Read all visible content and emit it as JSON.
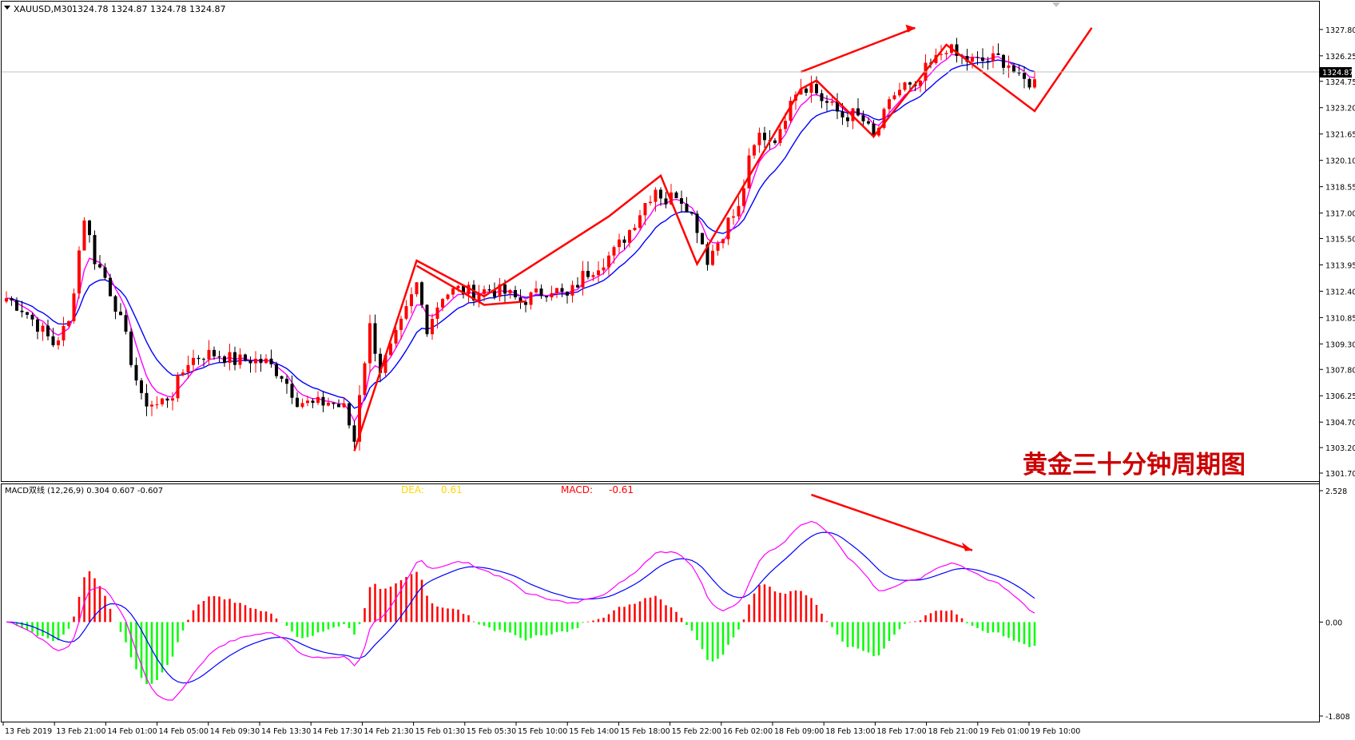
{
  "window": {
    "symbol_label": "XAUUSD,M30",
    "ohlc": "1324.78 1324.87 1324.78 1324.87",
    "title_cn": "黄金三十分钟周期图"
  },
  "colors": {
    "bull_candle": "#ff0000",
    "bear_candle": "#000000",
    "fast_ma": "#ff00ff",
    "slow_ma": "#0000ff",
    "macd_pos": "#ff0000",
    "macd_neg": "#00ff00",
    "trendline": "#ff0000",
    "title": "#cc0000",
    "dea_label": "#ffd700",
    "macd_label": "#ff0000"
  },
  "price_axis": {
    "ticks": [
      "1327.80",
      "1326.25",
      "1324.75",
      "1323.20",
      "1321.65",
      "1320.10",
      "1318.55",
      "1317.00",
      "1315.50",
      "1313.95",
      "1312.40",
      "1310.85",
      "1309.30",
      "1307.80",
      "1306.25",
      "1304.70",
      "1303.20",
      "1301.70"
    ],
    "current_price": "1324.87"
  },
  "time_axis": {
    "labels": [
      "13 Feb 2019",
      "13 Feb 21:00",
      "14 Feb 01:00",
      "14 Feb 05:00",
      "14 Feb 09:30",
      "14 Feb 13:30",
      "14 Feb 17:30",
      "14 Feb 21:30",
      "15 Feb 01:30",
      "15 Feb 05:30",
      "15 Feb 10:00",
      "15 Feb 14:00",
      "15 Feb 18:00",
      "15 Feb 22:00",
      "16 Feb 02:00",
      "18 Feb 09:00",
      "18 Feb 13:00",
      "18 Feb 17:00",
      "18 Feb 21:00",
      "19 Feb 01:00",
      "19 Feb 10:00"
    ]
  },
  "macd_panel": {
    "label": "MACD双线 (12,26,9) 0.304 0.607 -0.607",
    "dea_name": "DEA:",
    "dea_value": "0.61",
    "macd_name": "MACD:",
    "macd_value": "-0.61",
    "ticks": [
      "2.528",
      "0.00",
      "-1.808"
    ]
  },
  "chart_data": {
    "type": "candlestick",
    "symbol": "XAUUSD",
    "timeframe": "M30",
    "ylim": [
      1301.7,
      1328.5
    ],
    "price_path": [
      [
        0,
        1312.0
      ],
      [
        3,
        1311.4
      ],
      [
        6,
        1310.4
      ],
      [
        9,
        1309.3
      ],
      [
        12,
        1310.5
      ],
      [
        14,
        1314.8
      ],
      [
        15,
        1316.8
      ],
      [
        17,
        1314.3
      ],
      [
        19,
        1313.2
      ],
      [
        21,
        1311.6
      ],
      [
        23,
        1309.6
      ],
      [
        26,
        1306.0
      ],
      [
        29,
        1305.7
      ],
      [
        32,
        1306.4
      ],
      [
        35,
        1308.3
      ],
      [
        38,
        1308.7
      ],
      [
        41,
        1308.7
      ],
      [
        44,
        1308.3
      ],
      [
        47,
        1308.4
      ],
      [
        50,
        1308.2
      ],
      [
        53,
        1307.5
      ],
      [
        56,
        1306.0
      ],
      [
        59,
        1305.7
      ],
      [
        62,
        1305.9
      ],
      [
        65,
        1305.5
      ],
      [
        67,
        1303.6
      ],
      [
        68,
        1306.5
      ],
      [
        70,
        1310.3
      ],
      [
        72,
        1307.8
      ],
      [
        74,
        1309.0
      ],
      [
        76,
        1310.4
      ],
      [
        79,
        1312.8
      ],
      [
        81,
        1310.3
      ],
      [
        84,
        1312.2
      ],
      [
        87,
        1312.5
      ],
      [
        90,
        1312.3
      ],
      [
        93,
        1312.5
      ],
      [
        96,
        1312.3
      ],
      [
        99,
        1311.8
      ],
      [
        102,
        1312.2
      ],
      [
        105,
        1312.6
      ],
      [
        108,
        1312.0
      ],
      [
        111,
        1313.3
      ],
      [
        114,
        1314.0
      ],
      [
        117,
        1314.7
      ],
      [
        120,
        1316.0
      ],
      [
        123,
        1317.6
      ],
      [
        125,
        1318.5
      ],
      [
        127,
        1317.7
      ],
      [
        129,
        1318.2
      ],
      [
        131,
        1317.5
      ],
      [
        133,
        1316.2
      ],
      [
        135,
        1314.3
      ],
      [
        137,
        1315.3
      ],
      [
        139,
        1316.5
      ],
      [
        141,
        1317.2
      ],
      [
        143,
        1320.0
      ],
      [
        145,
        1321.6
      ],
      [
        147,
        1321.4
      ],
      [
        149,
        1321.6
      ],
      [
        151,
        1324.0
      ],
      [
        153,
        1324.5
      ],
      [
        155,
        1324.5
      ],
      [
        157,
        1323.7
      ],
      [
        159,
        1323.2
      ],
      [
        161,
        1322.7
      ],
      [
        163,
        1322.8
      ],
      [
        165,
        1322.4
      ],
      [
        167,
        1321.4
      ],
      [
        169,
        1322.7
      ],
      [
        171,
        1324.0
      ],
      [
        173,
        1324.5
      ],
      [
        175,
        1324.1
      ],
      [
        177,
        1325.4
      ],
      [
        179,
        1326.0
      ],
      [
        181,
        1326.8
      ],
      [
        183,
        1326.2
      ],
      [
        185,
        1326.0
      ],
      [
        187,
        1325.9
      ],
      [
        189,
        1326.0
      ],
      [
        191,
        1326.1
      ],
      [
        193,
        1325.8
      ],
      [
        195,
        1324.8
      ],
      [
        197,
        1324.7
      ],
      [
        198,
        1324.87
      ]
    ],
    "moving_averages": [
      {
        "color": "#ff00ff",
        "period": "fast"
      },
      {
        "color": "#0000ff",
        "period": "slow"
      }
    ],
    "trendlines": [
      [
        [
          1303.0,
          1303.0
        ],
        [
          1314.2,
          1314.2
        ]
      ],
      [
        [
          1314.2,
          1314.2
        ],
        [
          1312.1,
          1312.1
        ]
      ]
    ],
    "macd": {
      "params": [
        12,
        26,
        9
      ],
      "values": {
        "macd": 0.304,
        "signal": 0.607,
        "histogram": -0.607
      },
      "ylim": [
        -1.808,
        2.528
      ]
    }
  }
}
